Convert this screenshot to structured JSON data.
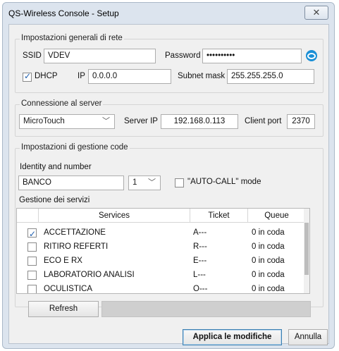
{
  "window": {
    "title": "QS-Wireless Console - Setup",
    "close_glyph": "✕"
  },
  "network": {
    "legend": "Impostazioni generali di rete",
    "ssid_label": "SSID",
    "ssid_value": "VDEV",
    "password_label": "Password",
    "password_value": "••••••••••",
    "dhcp_label": "DHCP",
    "dhcp_checked": true,
    "ip_label": "IP",
    "ip_value": "0.0.0.0",
    "subnet_label": "Subnet mask",
    "subnet_value": "255.255.255.0",
    "eye_icon": "eye-icon"
  },
  "server": {
    "legend": "Connessione al server",
    "type_value": "MicroTouch",
    "server_ip_label": "Server IP",
    "server_ip_value": "192.168.0.113",
    "client_port_label": "Client port",
    "client_port_value": "2370"
  },
  "queue": {
    "legend": "Impostazioni di gestione code",
    "identity_label": "Identity and number",
    "identity_value": "BANCO",
    "number_value": "1",
    "autocall_label": "\"AUTO-CALL\" mode",
    "autocall_checked": false
  },
  "services": {
    "legend": "Gestione dei servizi",
    "columns": [
      "Services",
      "Ticket",
      "Queue"
    ],
    "rows": [
      {
        "name": "ACCETTAZIONE",
        "ticket": "A---",
        "queue": "0 in coda",
        "checked": true
      },
      {
        "name": "RITIRO REFERTI",
        "ticket": "R---",
        "queue": "0 in coda",
        "checked": false
      },
      {
        "name": "ECO E RX",
        "ticket": "E---",
        "queue": "0 in coda",
        "checked": false
      },
      {
        "name": "LABORATORIO ANALISI",
        "ticket": "L---",
        "queue": "0 in coda",
        "checked": false
      },
      {
        "name": "OCULISTICA",
        "ticket": "O---",
        "queue": "0 in coda",
        "checked": false
      }
    ]
  },
  "footer": {
    "refresh_label": "Refresh",
    "apply_label": "Applica le modifiche",
    "cancel_label": "Annulla"
  },
  "colors": {
    "accent": "#1a8fd6",
    "check": "#1f5fae"
  }
}
